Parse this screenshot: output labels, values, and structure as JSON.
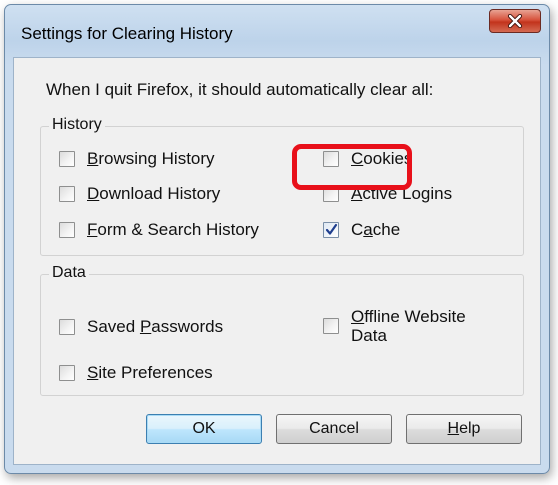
{
  "window": {
    "title": "Settings for Clearing History",
    "close_icon": "close-icon"
  },
  "prompt": "When I quit Firefox, it should automatically clear all:",
  "history_group": {
    "legend": "History",
    "items": [
      {
        "pre": "",
        "key": "B",
        "post": "rowsing History",
        "checked": false
      },
      {
        "pre": "",
        "key": "D",
        "post": "ownload History",
        "checked": false
      },
      {
        "pre": "",
        "key": "F",
        "post": "orm & Search History",
        "checked": false
      },
      {
        "pre": "",
        "key": "C",
        "post": "ookies",
        "checked": false
      },
      {
        "pre": "",
        "key": "A",
        "post": "ctive Logins",
        "checked": false
      },
      {
        "pre": "C",
        "key": "a",
        "post": "che",
        "checked": true
      }
    ]
  },
  "data_group": {
    "legend": "Data",
    "items": [
      {
        "pre": "Saved ",
        "key": "P",
        "post": "asswords",
        "checked": false
      },
      {
        "pre": "",
        "key": "S",
        "post": "ite Preferences",
        "checked": false
      },
      {
        "pre": "",
        "key": "O",
        "post": "ffline Website",
        "line2": "Data",
        "checked": false
      }
    ]
  },
  "buttons": {
    "ok": "OK",
    "cancel": "Cancel",
    "help_key": "H",
    "help_rest": "elp"
  },
  "colors": {
    "highlight": "#e8101a",
    "close_button": "#c2331c"
  }
}
